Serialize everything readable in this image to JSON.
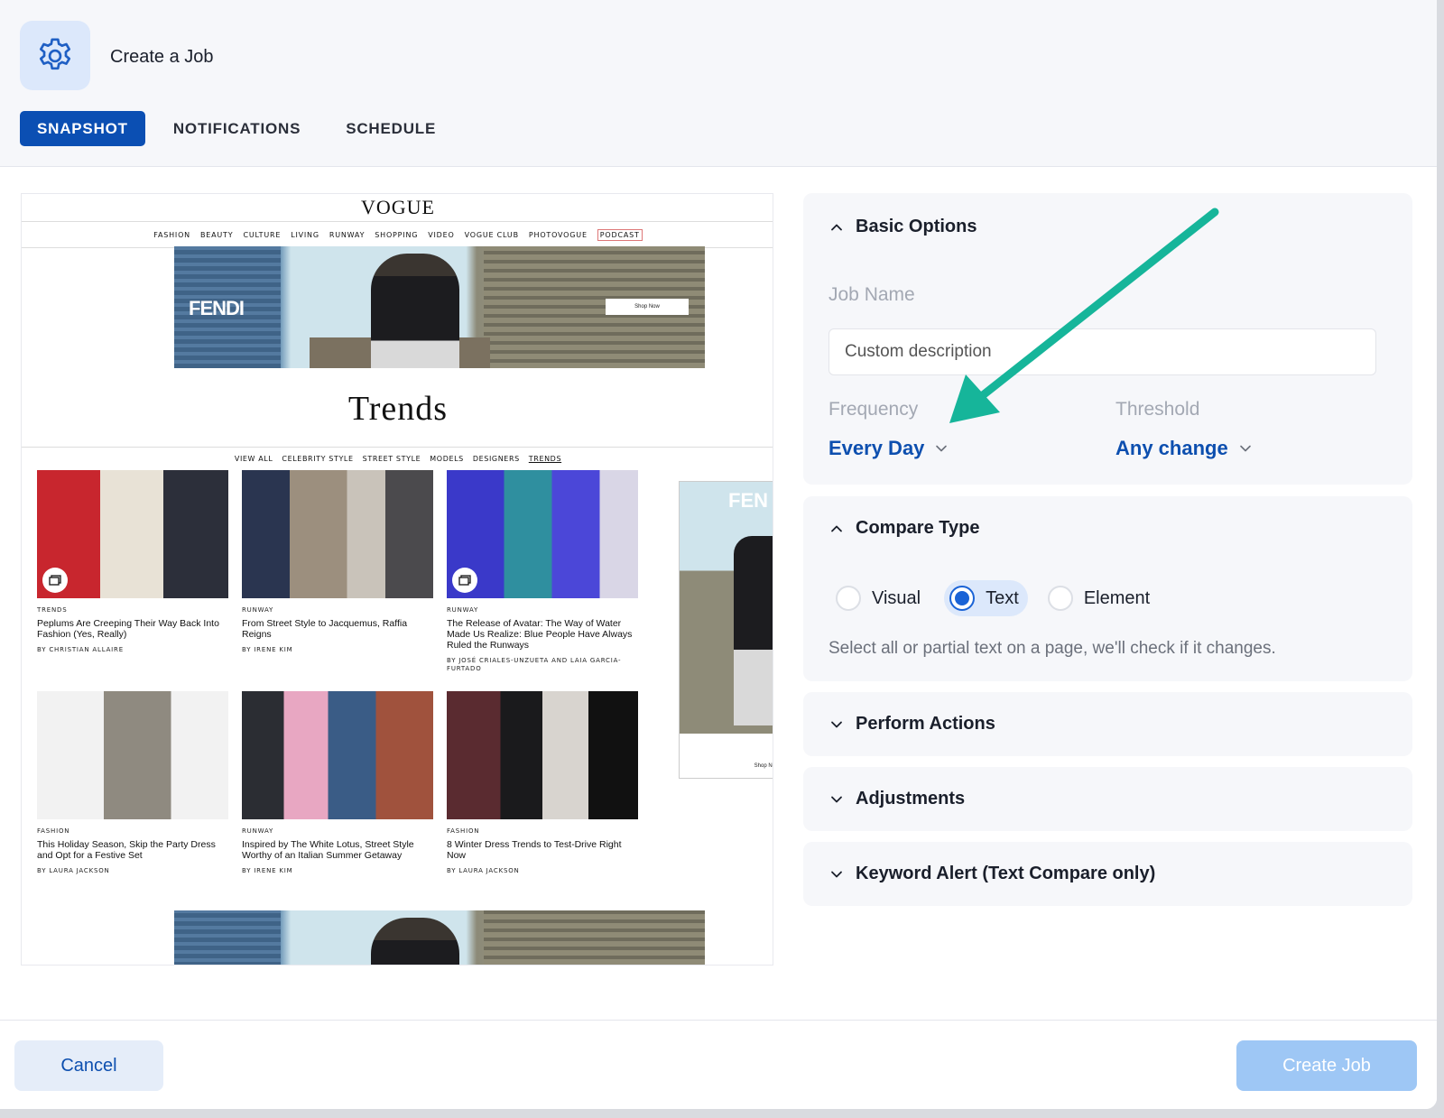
{
  "header": {
    "title": "Create a Job",
    "icon": "gear-icon",
    "tabs": [
      {
        "label": "SNAPSHOT",
        "active": true
      },
      {
        "label": "NOTIFICATIONS",
        "active": false
      },
      {
        "label": "SCHEDULE",
        "active": false
      }
    ]
  },
  "snapshot": {
    "logo": "VOGUE",
    "nav": [
      "FASHION",
      "BEAUTY",
      "CULTURE",
      "LIVING",
      "RUNWAY",
      "SHOPPING",
      "VIDEO",
      "VOGUE CLUB",
      "PHOTOVOGUE",
      "PODCAST"
    ],
    "ad_brand": "FENDI",
    "ad_cta": "Shop Now",
    "side_ad_brand": "FEN",
    "side_ad_cta": "Shop No",
    "page_title": "Trends",
    "subnav": [
      "VIEW ALL",
      "CELEBRITY STYLE",
      "STREET STYLE",
      "MODELS",
      "DESIGNERS",
      "TRENDS"
    ],
    "cards": [
      {
        "category": "TRENDS",
        "headline": "Peplums Are Creeping Their Way Back Into Fashion (Yes, Really)",
        "byline": "BY CHRISTIAN ALLAIRE"
      },
      {
        "category": "RUNWAY",
        "headline": "From Street Style to Jacquemus, Raffia Reigns",
        "byline": "BY IRENE KIM"
      },
      {
        "category": "RUNWAY",
        "headline": "The Release of Avatar: The Way of Water Made Us Realize: Blue People Have Always Ruled the Runways",
        "byline": "BY JOSÉ CRIALES-UNZUETA AND LAIA GARCIA-FURTADO"
      },
      {
        "category": "FASHION",
        "headline": "This Holiday Season, Skip the Party Dress and Opt for a Festive Set",
        "byline": "BY LAURA JACKSON"
      },
      {
        "category": "RUNWAY",
        "headline": "Inspired by The White Lotus, Street Style Worthy of an Italian Summer Getaway",
        "byline": "BY IRENE KIM"
      },
      {
        "category": "FASHION",
        "headline": "8 Winter Dress Trends to Test-Drive Right Now",
        "byline": "BY LAURA JACKSON"
      }
    ]
  },
  "basic_options": {
    "title": "Basic Options",
    "job_name_label": "Job Name",
    "job_name_value": "",
    "job_name_placeholder": "Custom description",
    "frequency_label": "Frequency",
    "frequency_value": "Every Day",
    "threshold_label": "Threshold",
    "threshold_value": "Any change"
  },
  "compare_type": {
    "title": "Compare Type",
    "options": [
      {
        "label": "Visual",
        "checked": false
      },
      {
        "label": "Text",
        "checked": true
      },
      {
        "label": "Element",
        "checked": false
      }
    ],
    "help": "Select all or partial text on a page, we'll check if it changes."
  },
  "sections": {
    "perform_actions": "Perform Actions",
    "adjustments": "Adjustments",
    "keyword_alert": "Keyword Alert (Text Compare only)"
  },
  "footer": {
    "cancel_label": "Cancel",
    "create_label": "Create Job"
  },
  "colors": {
    "primary": "#0b4fb3",
    "accent_arrow": "#16b59a",
    "create_disabled": "#9ec7f5"
  }
}
